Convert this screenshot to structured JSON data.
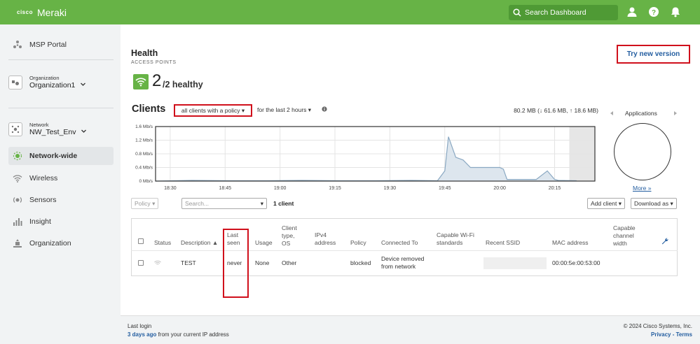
{
  "header": {
    "brand_top": "cisco",
    "brand": "Meraki",
    "search_placeholder": "Search Dashboard"
  },
  "sidebar": {
    "msp_portal": "MSP Portal",
    "org_label": "Organization",
    "org_value": "Organization1",
    "network_label": "Network",
    "network_value": "NW_Test_Env",
    "items": [
      {
        "label": "Network-wide"
      },
      {
        "label": "Wireless"
      },
      {
        "label": "Sensors"
      },
      {
        "label": "Insight"
      },
      {
        "label": "Organization"
      }
    ]
  },
  "health": {
    "title": "Health",
    "subtitle": "ACCESS POINTS",
    "count": "2",
    "suffix": "/2 healthy"
  },
  "try_new_version": "Try new version",
  "clients": {
    "title": "Clients",
    "filter": "all clients with a policy",
    "period": "for the last 2 hours",
    "usage": "80.2 MB (↓ 61.6 MB, ↑ 18.6 MB)"
  },
  "chart_data": {
    "type": "area",
    "y_ticks": [
      "1.6 Mb/s",
      "1.2 Mb/s",
      "0.8 Mb/s",
      "0.4 Mb/s",
      "0 Mb/s"
    ],
    "x_ticks": [
      "18:30",
      "18:45",
      "19:00",
      "19:15",
      "19:30",
      "19:45",
      "20:00",
      "20:15"
    ],
    "ylim": [
      0,
      1.6
    ],
    "series": [
      {
        "x": [
          "18:26",
          "18:36",
          "18:46",
          "18:56",
          "19:06",
          "19:16",
          "19:26",
          "19:36",
          "19:43",
          "19:45",
          "19:46",
          "19:48",
          "19:50",
          "19:52",
          "20:00",
          "20:01",
          "20:02",
          "20:10",
          "20:13",
          "20:15",
          "20:16",
          "20:21"
        ],
        "values": [
          0,
          0.02,
          0.01,
          0.01,
          0.02,
          0.01,
          0.01,
          0.02,
          0.01,
          0.3,
          1.3,
          0.7,
          0.62,
          0.4,
          0.4,
          0.35,
          0.05,
          0.05,
          0.3,
          0.05,
          0.02,
          0.01
        ]
      }
    ]
  },
  "applications": {
    "label": "Applications",
    "more": "More »"
  },
  "controls": {
    "policy": "Policy",
    "search_placeholder": "Search...",
    "count": "1 client",
    "add_client": "Add client",
    "download": "Download as"
  },
  "table": {
    "headers": [
      "Status",
      "Description ▲",
      "Last seen",
      "Usage",
      "Client type, OS",
      "IPv4 address",
      "Policy",
      "Connected To",
      "Capable Wi-Fi standards",
      "Recent SSID",
      "MAC address",
      "Capable channel width"
    ],
    "rows": [
      {
        "description": "TEST",
        "last_seen": "never",
        "usage": "None",
        "os": "Other",
        "policy": "blocked",
        "connected": "Device removed from network",
        "mac": "00:00:5e:00:53:00"
      }
    ]
  },
  "footer": {
    "last_login": "Last login",
    "ago": "3 days ago",
    "from": " from your current IP address",
    "copyright": "© 2024 Cisco Systems, Inc.",
    "privacy": "Privacy",
    "sep": " - ",
    "terms": "Terms"
  },
  "colors": {
    "brand_green": "#67b346",
    "highlight_red": "#d0101c",
    "link_blue": "#245ea0"
  }
}
